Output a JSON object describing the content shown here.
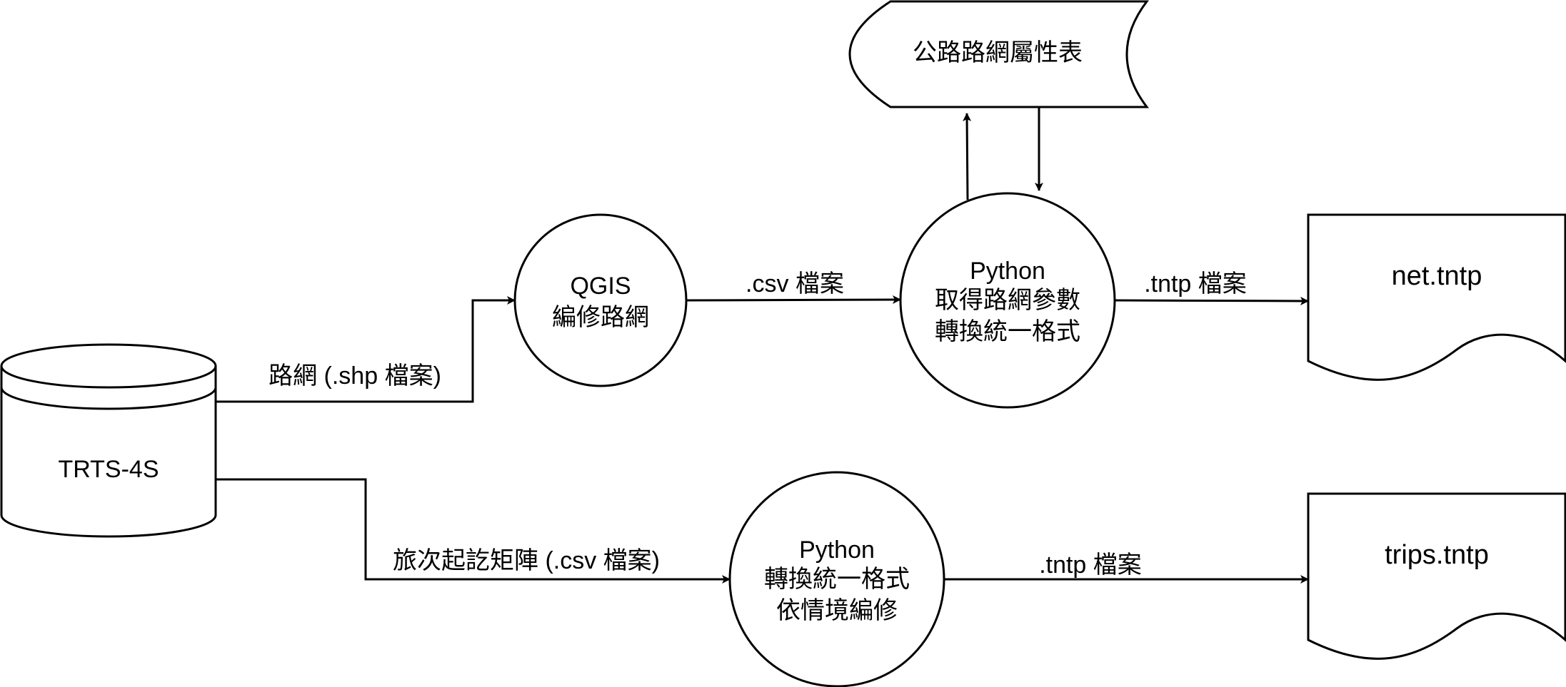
{
  "nodes": {
    "database": {
      "label": "TRTS-4S"
    },
    "qgis": {
      "line1": "QGIS",
      "line2": "編修路網"
    },
    "python_net": {
      "line1": "Python",
      "line2": "取得路網參數",
      "line3": "轉換統一格式"
    },
    "python_trips": {
      "line1": "Python",
      "line2": "轉換統一格式",
      "line3": "依情境編修"
    },
    "attribute_table": {
      "label": "公路路網屬性表"
    },
    "net_file": {
      "label": "net.tntp"
    },
    "trips_file": {
      "label": "trips.tntp"
    }
  },
  "edges": {
    "db_to_qgis": "路網 (.shp 檔案)",
    "qgis_to_python": ".csv 檔案",
    "python_to_net": ".tntp 檔案",
    "db_to_python_trips": "旅次起訖矩陣 (.csv 檔案)",
    "python_trips_to_file": ".tntp 檔案"
  }
}
